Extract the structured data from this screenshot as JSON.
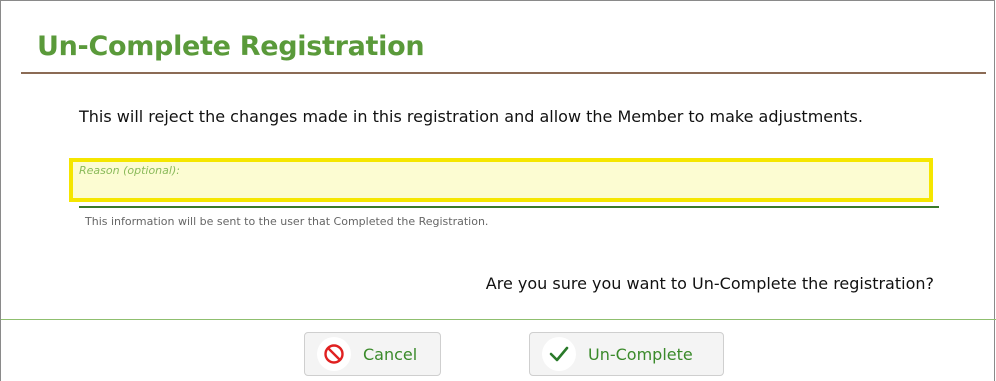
{
  "dialog": {
    "title": "Un-Complete Registration",
    "message": "This will reject the changes made in this registration and allow the Member to make adjustments.",
    "reason": {
      "label": "Reason (optional):",
      "value": "",
      "hint": "This information will be sent to the user that Completed the Registration."
    },
    "confirm_text": "Are you sure you want to Un-Complete the registration?",
    "buttons": {
      "cancel_label": "Cancel",
      "uncomplete_label": "Un-Complete"
    }
  },
  "icons": {
    "cancel": "prohibited-icon",
    "confirm": "checkmark-icon"
  },
  "colors": {
    "title": "#5a9a3a",
    "highlight_border": "#f5e600",
    "cancel_icon": "#e02020",
    "confirm_icon": "#2a7a2a"
  }
}
